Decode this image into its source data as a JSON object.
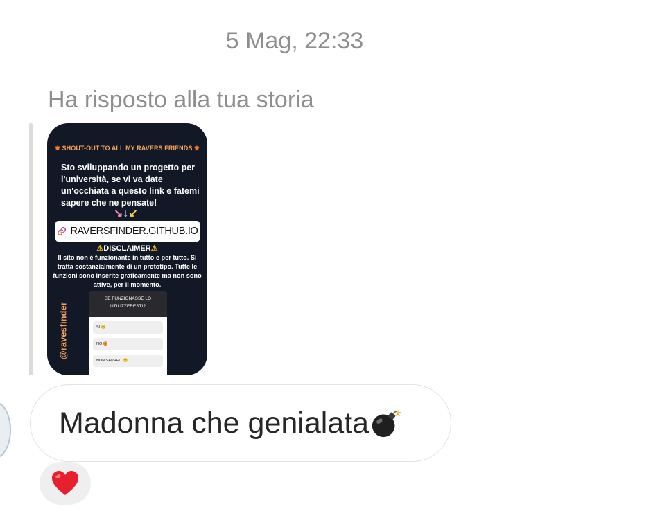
{
  "thread": {
    "timestamp": "5 Mag, 22:33",
    "reply_label": "Ha risposto alla tua storia"
  },
  "story": {
    "shout_out": "SHOUT-OUT TO ALL MY RAVERS FRIENDS",
    "body_text": "Sto sviluppando un progetto per l'università, se vi va date un'occhiata a questo link e fatemi sapere che ne pensate!",
    "arrows": [
      "↘",
      "↓",
      "↙"
    ],
    "link_text": "RAVERSFINDER.GITHUB.IO",
    "disclaimer_title": "DISCLAIMER",
    "disclaimer_text": "Il sito non è funzionante in tutto e per tutto. Si tratta sostanzialmente di un prototipo. Tutte le funzioni sono inserite graficamente ma non sono attive, per il momento.",
    "handle": "@ravesfinder",
    "poll": {
      "question": "SE FUNZIONASSE LO UTILIZZERESTI?",
      "options": [
        "SI 😄",
        "NO 😡",
        "NON SAPREI...😉"
      ]
    }
  },
  "message": {
    "text": "Madonna che genialata",
    "emoji": "bomb-emoji"
  },
  "reaction": {
    "emoji": "red-heart"
  },
  "colors": {
    "timestamp_gray": "#8e8e8e",
    "story_bg": "#131826",
    "accent_orange": "#f3a35f",
    "heart_red": "#e8202e"
  }
}
